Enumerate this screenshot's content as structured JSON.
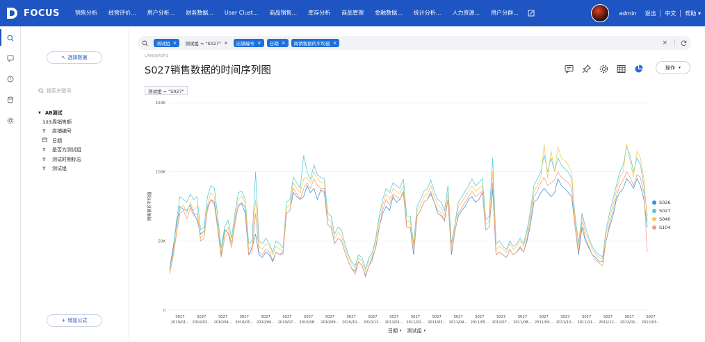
{
  "app": {
    "logo_text": "FOCUS"
  },
  "nav": {
    "items": [
      {
        "label": "销售分析"
      },
      {
        "label": "经营评价..."
      },
      {
        "label": "用户分析..."
      },
      {
        "label": "财务数据..."
      },
      {
        "label": "User Clust..."
      },
      {
        "label": "商品销售..."
      },
      {
        "label": "库存分析"
      },
      {
        "label": "商品管理"
      },
      {
        "label": "金融数据..."
      },
      {
        "label": "统计分析..."
      },
      {
        "label": "人力资源..."
      },
      {
        "label": "用户分群..."
      }
    ],
    "edit_icon": "edit-icon"
  },
  "topright": {
    "user": "admin",
    "logout": "退出",
    "lang": "中文",
    "help": "帮助"
  },
  "sidepanel": {
    "select_data": "选择数据",
    "search_placeholder": "搜索关键词",
    "group": "AB测试",
    "fields": [
      {
        "type_icon": "123",
        "label": "周销售额"
      },
      {
        "type_icon": "T",
        "label": "店铺编号"
      },
      {
        "type_icon": "cal",
        "label": "日期"
      },
      {
        "type_icon": "T",
        "label": "是否为测试组"
      },
      {
        "type_icon": "T",
        "label": "测试时期标志"
      },
      {
        "type_icon": "T",
        "label": "测试组"
      }
    ],
    "add_formula": "增加公式"
  },
  "filterbar": {
    "chips": [
      {
        "label": "测试组",
        "style": "blue"
      },
      {
        "label": "测试组 = \"S027\"",
        "style": "plain"
      },
      {
        "label": "店铺编号",
        "style": "blue"
      },
      {
        "label": "日期",
        "style": "blue"
      },
      {
        "label": "周销售额的平均值",
        "style": "blue"
      }
    ]
  },
  "page": {
    "breadcrumb": "LANSWER1",
    "title": "S027销售数据的时间序列图",
    "operate": "操作",
    "filter_tag": "测试组 = \"S027\""
  },
  "toolbar": {
    "icons": [
      "comment-icon",
      "pin-icon",
      "settings-icon",
      "table-icon",
      "pie-chart-icon"
    ]
  },
  "chart_data": {
    "type": "line",
    "title": "",
    "xlabel": "日期",
    "xlabel2": "测试组",
    "ylabel": "销售额的平均值",
    "ylim": [
      0,
      150000
    ],
    "y_ticks": [
      {
        "value": 0,
        "label": "0"
      },
      {
        "value": 50000,
        "label": "50K"
      },
      {
        "value": 100000,
        "label": "100K"
      },
      {
        "value": 150000,
        "label": "150K"
      }
    ],
    "x_ticks": [
      {
        "top": "S027",
        "bottom": "2010/01..."
      },
      {
        "top": "S027",
        "bottom": "2010/02..."
      },
      {
        "top": "S027",
        "bottom": "2010/04..."
      },
      {
        "top": "S027",
        "bottom": "2010/05..."
      },
      {
        "top": "S027",
        "bottom": "2010/06..."
      },
      {
        "top": "S027",
        "bottom": "2010/07..."
      },
      {
        "top": "S027",
        "bottom": "2010/08..."
      },
      {
        "top": "S027",
        "bottom": "2010/09..."
      },
      {
        "top": "S027",
        "bottom": "2010/10..."
      },
      {
        "top": "S027",
        "bottom": "2010/12..."
      },
      {
        "top": "S027",
        "bottom": "2011/01..."
      },
      {
        "top": "S027",
        "bottom": "2011/02..."
      },
      {
        "top": "S027",
        "bottom": "2011/03..."
      },
      {
        "top": "S027",
        "bottom": "2011/04..."
      },
      {
        "top": "S027",
        "bottom": "2011/05..."
      },
      {
        "top": "S027",
        "bottom": "2011/07..."
      },
      {
        "top": "S027",
        "bottom": "2011/08..."
      },
      {
        "top": "S027",
        "bottom": "2011/09..."
      },
      {
        "top": "S027",
        "bottom": "2011/10..."
      },
      {
        "top": "S027",
        "bottom": "2011/11..."
      },
      {
        "top": "S027",
        "bottom": "2011/12..."
      },
      {
        "top": "S027",
        "bottom": "2012/01..."
      },
      {
        "top": "S027",
        "bottom": "2012/03..."
      }
    ],
    "series": [
      {
        "name": "S026",
        "color": "#3b8fd6",
        "values": [
          30000,
          45000,
          62000,
          75000,
          73000,
          72000,
          76000,
          70000,
          65000,
          55000,
          57000,
          74000,
          80000,
          78000,
          60000,
          40000,
          58000,
          56000,
          48000,
          65000,
          75000,
          77000,
          70000,
          40000,
          45000,
          55000,
          40000,
          38000,
          42000,
          40000,
          35000,
          42000,
          40000,
          42000,
          70000,
          72000,
          85000,
          82000,
          80000,
          82000,
          90000,
          85000,
          88000,
          80000,
          87000,
          85000,
          62000,
          60000,
          48000,
          52000,
          50000,
          42000,
          35000,
          30000,
          28000,
          35000,
          32000,
          25000,
          32000,
          38000,
          45000,
          60000,
          70000,
          75000,
          72000,
          82000,
          78000,
          80000,
          85000,
          60000,
          60000,
          40000,
          68000,
          72000,
          78000,
          80000,
          84000,
          78000,
          70000,
          68000,
          65000,
          80000,
          40000,
          57000,
          68000,
          72000,
          75000,
          80000,
          82000,
          78000,
          80000,
          85000,
          58000,
          60000,
          88000,
          40000,
          42000,
          40000,
          38000,
          44000,
          40000,
          42000,
          45000,
          42000,
          50000,
          62000,
          78000,
          80000,
          85000,
          88000,
          85000,
          82000,
          85000,
          95000,
          90000,
          88000,
          85000,
          82000,
          60000,
          40000,
          60000,
          50000,
          45000,
          40000,
          38000,
          35000,
          35000,
          50000,
          60000,
          68000,
          80000,
          85000,
          88000,
          95000,
          92000,
          88000,
          95000,
          90000,
          80000,
          60000
        ]
      },
      {
        "name": "S027",
        "color": "#4fc8d8",
        "values": [
          30000,
          42000,
          65000,
          82000,
          80000,
          78000,
          84000,
          80000,
          82000,
          58000,
          60000,
          82000,
          90000,
          88000,
          68000,
          45000,
          60000,
          65000,
          52000,
          70000,
          85000,
          86000,
          80000,
          48000,
          50000,
          100000,
          50000,
          48000,
          52000,
          48000,
          42000,
          50000,
          48000,
          45000,
          78000,
          80000,
          96000,
          92000,
          88000,
          112000,
          100000,
          95000,
          105000,
          98000,
          96000,
          95000,
          70000,
          68000,
          55000,
          60000,
          58000,
          48000,
          40000,
          35000,
          32000,
          40000,
          38000,
          30000,
          38000,
          42000,
          52000,
          68000,
          80000,
          88000,
          85000,
          92000,
          90000,
          88000,
          95000,
          68000,
          68000,
          48000,
          75000,
          80000,
          86000,
          88000,
          94000,
          86000,
          80000,
          78000,
          72000,
          90000,
          48000,
          62000,
          78000,
          82000,
          86000,
          90000,
          95000,
          90000,
          92000,
          95000,
          65000,
          68000,
          110000,
          48000,
          50000,
          46000,
          44000,
          50000,
          46000,
          48000,
          52000,
          48000,
          58000,
          72000,
          90000,
          95000,
          100000,
          112000,
          100000,
          110000,
          100000,
          110000,
          105000,
          102000,
          100000,
          95000,
          68000,
          48000,
          70000,
          60000,
          52000,
          46000,
          42000,
          40000,
          38000,
          58000,
          70000,
          80000,
          90000,
          100000,
          105000,
          118000,
          112000,
          100000,
          110000,
          105000,
          90000,
          68000
        ]
      },
      {
        "name": "S040",
        "color": "#f4c95e",
        "values": [
          28000,
          40000,
          58000,
          72000,
          76000,
          70000,
          78000,
          72000,
          75000,
          52000,
          55000,
          76000,
          85000,
          82000,
          62000,
          42000,
          55000,
          60000,
          48000,
          66000,
          80000,
          82000,
          78000,
          44000,
          46000,
          80000,
          46000,
          44000,
          48000,
          46000,
          40000,
          46000,
          44000,
          43000,
          74000,
          76000,
          92000,
          88000,
          85000,
          95000,
          96000,
          92000,
          100000,
          95000,
          92000,
          92000,
          66000,
          64000,
          52000,
          56000,
          54000,
          45000,
          38000,
          33000,
          30000,
          38000,
          35000,
          28000,
          36000,
          40000,
          50000,
          64000,
          76000,
          84000,
          80000,
          88000,
          86000,
          84000,
          90000,
          64000,
          64000,
          45000,
          72000,
          76000,
          82000,
          84000,
          90000,
          82000,
          76000,
          74000,
          68000,
          85000,
          45000,
          60000,
          75000,
          78000,
          82000,
          86000,
          90000,
          86000,
          88000,
          90000,
          62000,
          64000,
          100000,
          44000,
          46000,
          44000,
          42000,
          48000,
          44000,
          46000,
          50000,
          46000,
          56000,
          70000,
          86000,
          90000,
          96000,
          120000,
          95000,
          115000,
          100000,
          118000,
          110000,
          108000,
          105000,
          100000,
          64000,
          46000,
          68000,
          56000,
          50000,
          44000,
          40000,
          38000,
          36000,
          55000,
          66000,
          76000,
          86000,
          96000,
          100000,
          120000,
          108000,
          96000,
          115000,
          110000,
          95000,
          64000
        ]
      },
      {
        "name": "S104",
        "color": "#f29b7c",
        "values": [
          26000,
          38000,
          55000,
          70000,
          72000,
          66000,
          74000,
          68000,
          70000,
          50000,
          52000,
          72000,
          80000,
          76000,
          58000,
          38000,
          52000,
          56000,
          45000,
          62000,
          76000,
          78000,
          74000,
          40000,
          42000,
          70000,
          42000,
          40000,
          44000,
          42000,
          36000,
          42000,
          40000,
          40000,
          70000,
          72000,
          88000,
          84000,
          80000,
          88000,
          92000,
          88000,
          95000,
          90000,
          88000,
          88000,
          62000,
          60000,
          48000,
          52000,
          50000,
          42000,
          35000,
          30000,
          26000,
          35000,
          32000,
          24000,
          32000,
          36000,
          46000,
          60000,
          72000,
          80000,
          76000,
          84000,
          82000,
          80000,
          86000,
          60000,
          60000,
          42000,
          68000,
          72000,
          78000,
          80000,
          86000,
          78000,
          72000,
          70000,
          64000,
          80000,
          42000,
          56000,
          70000,
          74000,
          78000,
          82000,
          86000,
          82000,
          84000,
          86000,
          58000,
          60000,
          92000,
          40000,
          42000,
          40000,
          38000,
          44000,
          40000,
          42000,
          46000,
          42000,
          52000,
          66000,
          82000,
          86000,
          92000,
          96000,
          90000,
          92000,
          94000,
          100000,
          96000,
          94000,
          92000,
          88000,
          60000,
          42000,
          64000,
          52000,
          46000,
          40000,
          36000,
          34000,
          32000,
          50000,
          62000,
          72000,
          82000,
          90000,
          94000,
          100000,
          96000,
          90000,
          98000,
          96000,
          85000,
          42000
        ]
      }
    ],
    "legend_position": "right",
    "grid": true
  }
}
